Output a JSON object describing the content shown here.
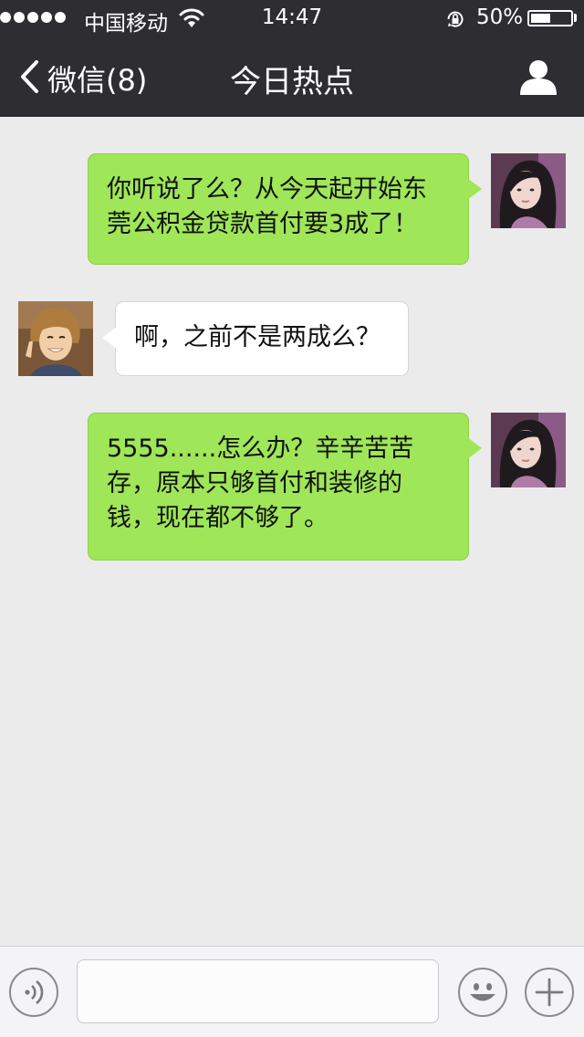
{
  "status_bar": {
    "carrier": "中国移动",
    "time": "14:47",
    "battery": "50%",
    "battery_level": 0.5,
    "signal_dots": 5,
    "icons": [
      "signal-dots-icon",
      "wifi-icon",
      "rotation-lock-icon",
      "battery-icon"
    ]
  },
  "nav": {
    "back_label": "微信(8)",
    "title": "今日热点",
    "icons": [
      "chevron-left-icon",
      "contact-profile-icon"
    ]
  },
  "messages": [
    {
      "direction": "outgoing",
      "avatar": "girl-avatar",
      "lines": [
        "你听说了么？从今天起开始东",
        "莞公积金贷款首付要3成了！"
      ]
    },
    {
      "direction": "incoming",
      "avatar": "boy-avatar",
      "lines": [
        "啊，之前不是两成么？"
      ]
    },
    {
      "direction": "outgoing",
      "avatar": "girl-avatar",
      "lines": [
        "5555......怎么办？辛辛苦苦",
        "存，原本只够首付和装修的",
        "钱，现在都不够了。"
      ]
    }
  ],
  "input_bar": {
    "text_value": "",
    "icons": [
      "voice-icon",
      "emoji-icon",
      "plus-icon"
    ]
  },
  "colors": {
    "nav_background": "#2e2e32",
    "chat_background": "#ebebeb",
    "outgoing_bubble": "#9fe658",
    "incoming_bubble": "#ffffff"
  }
}
